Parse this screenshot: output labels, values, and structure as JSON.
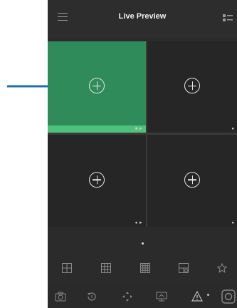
{
  "header": {
    "title": "Live Preview"
  },
  "icons": {
    "menu": "hamburger-menu-icon",
    "grid_switch": "grid-list-icon",
    "add": "plus-circle-icon",
    "layout_1": "four-pane-layout-icon",
    "layout_2": "nine-pane-layout-icon",
    "layout_3": "sixteen-pane-layout-icon",
    "layout_4": "custom-layout-icon",
    "favorite": "star-icon",
    "capture": "camera-icon",
    "playback": "replay-icon",
    "ptz": "ptz-arrows-icon",
    "display": "monitor-icon",
    "alarm": "warning-icon"
  },
  "colors": {
    "selected_tile": "#2f8b5a",
    "selected_strip": "#4cc27a",
    "annotation_arrow": "#1f6fb2"
  }
}
